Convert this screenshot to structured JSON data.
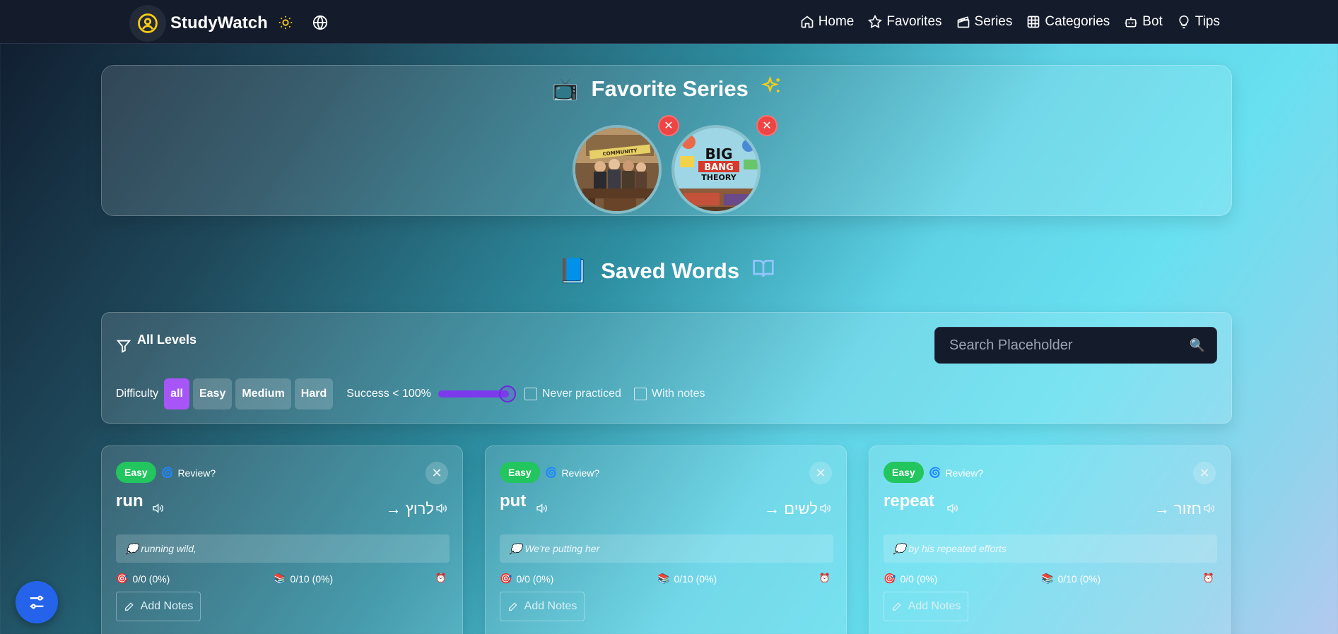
{
  "nav": {
    "brand": "StudyWatch",
    "links": [
      {
        "label": "Home",
        "icon": "home-icon"
      },
      {
        "label": "Favorites",
        "icon": "star-icon"
      },
      {
        "label": "Series",
        "icon": "clapperboard-icon"
      },
      {
        "label": "Categories",
        "icon": "grid-icon"
      },
      {
        "label": "Bot",
        "icon": "bot-icon"
      },
      {
        "label": "Tips",
        "icon": "lightbulb-icon"
      }
    ]
  },
  "favorites": {
    "title": "Favorite Series",
    "remove_symbol": "✕",
    "series": [
      {
        "poster": "poster-cast-classroom",
        "poster_text": "COMMUNITY"
      },
      {
        "poster": "poster-big-bang-theory",
        "poster_text": "BIG BANG THEORY"
      }
    ]
  },
  "saved": {
    "title": "Saved Words"
  },
  "filters": {
    "levels_label": "All Levels",
    "difficulty_label": "Difficulty",
    "chips": [
      "all",
      "Easy",
      "Medium",
      "Hard"
    ],
    "active_chip": "all",
    "success_label": "Success < 100%",
    "success_value": 100,
    "never_practiced": "Never practiced",
    "with_notes": "With notes",
    "search_placeholder": "Search Placeholder"
  },
  "cards": [
    {
      "level": "Easy",
      "review": "Review?",
      "word": "run",
      "translation": "→ לרוץ",
      "example": "💭 running wild,",
      "score": "0/0 (0%)",
      "progress": "0/10 (0%)",
      "notes": "Add Notes"
    },
    {
      "level": "Easy",
      "review": "Review?",
      "word": "put",
      "translation": "→ לשים",
      "example": "💭 We're putting her",
      "score": "0/0 (0%)",
      "progress": "0/10 (0%)",
      "notes": "Add Notes"
    },
    {
      "level": "Easy",
      "review": "Review?",
      "word": "repeat",
      "translation": "→ חזור",
      "example": "💭 by his repeated efforts",
      "score": "0/0 (0%)",
      "progress": "0/10 (0%)",
      "notes": "Add Notes"
    }
  ],
  "colors": {
    "accent": "#a855f7",
    "easy": "#22c55e",
    "remove": "#ef4444",
    "fab": "#2563eb"
  }
}
